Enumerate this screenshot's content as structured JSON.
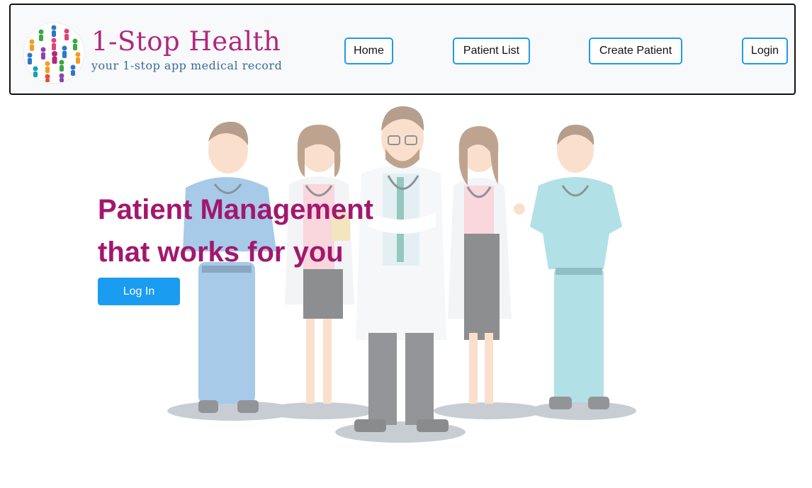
{
  "brand": {
    "title": "1-Stop Health",
    "subtitle": "your 1-stop app medical record",
    "logo_icon": "people-globe-icon"
  },
  "nav": {
    "home": "Home",
    "patient_list": "Patient List",
    "create_patient": "Create Patient",
    "login": "Login"
  },
  "hero": {
    "headline_line1": "Patient Management",
    "headline_line2": "that works for you",
    "cta_label": "Log In",
    "illustration": "medical-team-illustration"
  },
  "colors": {
    "brand_magenta": "#b0287e",
    "headline_magenta": "#a3176e",
    "subtitle_blue": "#3a6a9a",
    "button_blue": "#1a9cf0",
    "nav_border_blue": "#1e9be9",
    "navbar_bg": "#f8f9fa"
  }
}
